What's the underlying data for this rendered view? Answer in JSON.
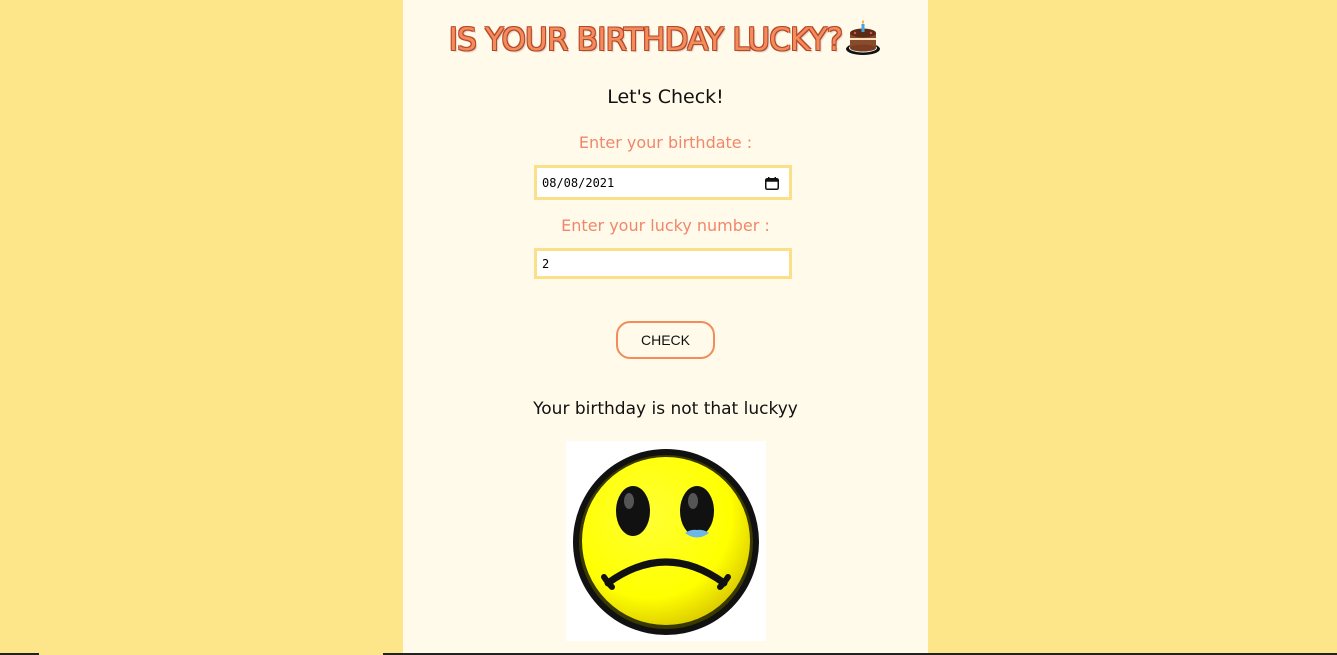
{
  "header": {
    "title": "IS YOUR BIRTHDAY LUCKY?",
    "title_icon": "birthday-cake-icon"
  },
  "form": {
    "subtitle": "Let's Check!",
    "birthdate_label": "Enter your birthdate :",
    "birthdate_value": "08/08/2021",
    "lucky_number_label": "Enter your lucky number :",
    "lucky_number_value": "2",
    "check_button_label": "CHECK"
  },
  "result": {
    "message": "Your birthday is not that luckyy",
    "image_icon": "sad-face-icon"
  },
  "colors": {
    "page_background": "#fde68a",
    "container_background": "#fffaea",
    "accent": "#f28c5a",
    "input_border": "#fbe08a"
  }
}
